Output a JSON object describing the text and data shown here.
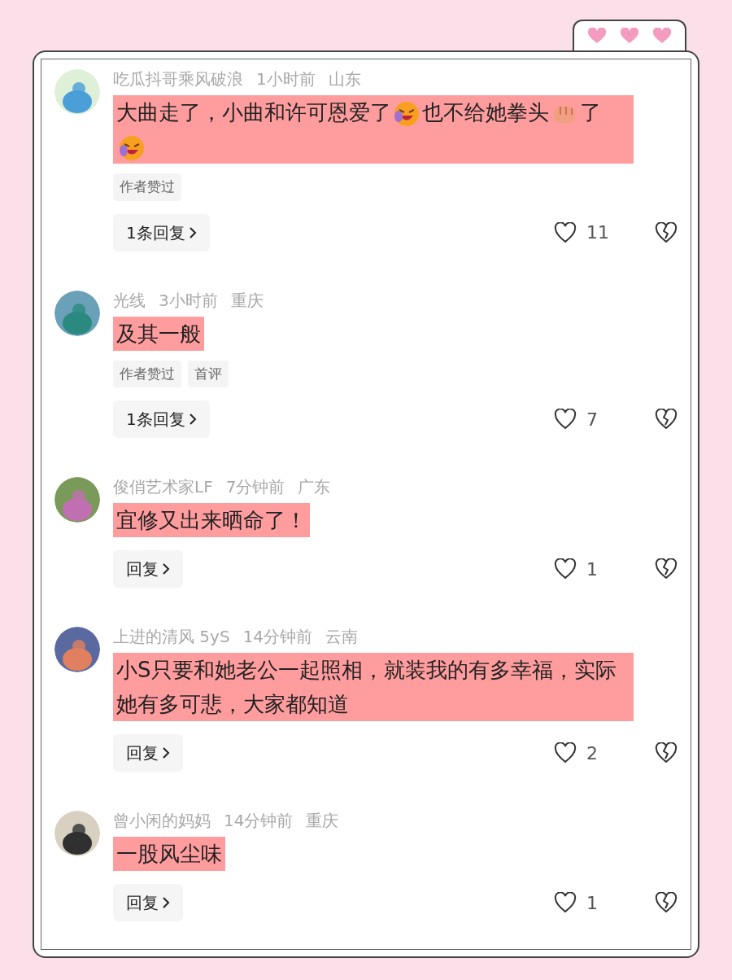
{
  "comments": [
    {
      "author": "吃瓜抖哥乘风破浪",
      "time": "1小时前",
      "location": "山东",
      "highlighted": true,
      "segments": [
        {
          "kind": "text",
          "text": "大曲走了，小曲和许可恩爱了"
        },
        {
          "kind": "laugh"
        },
        {
          "kind": "text",
          "text": "也不给她拳头"
        },
        {
          "kind": "fist"
        },
        {
          "kind": "text",
          "text": "了"
        },
        {
          "kind": "laugh"
        }
      ],
      "tags": [
        "作者赞过"
      ],
      "reply": "1条回复",
      "likes": "11"
    },
    {
      "author": "光线",
      "time": "3小时前",
      "location": "重庆",
      "highlighted": true,
      "segments": [
        {
          "kind": "text",
          "text": "及其一般"
        }
      ],
      "tags": [
        "作者赞过",
        "首评"
      ],
      "reply": "1条回复",
      "likes": "7"
    },
    {
      "author": "俊俏艺术家LF",
      "time": "7分钟前",
      "location": "广东",
      "highlighted": true,
      "segments": [
        {
          "kind": "text",
          "text": "宜修又出来晒命了！"
        }
      ],
      "reply": "回复",
      "likes": "1"
    },
    {
      "author": "上进的清风 5yS",
      "time": "14分钟前",
      "location": "云南",
      "highlighted": true,
      "segments": [
        {
          "kind": "text",
          "text": "小S只要和她老公一起照相，就装我的有多幸福，实际她有多可悲，大家都知道"
        }
      ],
      "reply": "回复",
      "likes": "2"
    },
    {
      "author": "曾小闲的妈妈",
      "time": "14分钟前",
      "location": "重庆",
      "highlighted": true,
      "segments": [
        {
          "kind": "text",
          "text": "一股风尘味"
        }
      ],
      "reply": "回复",
      "likes": "1"
    }
  ]
}
